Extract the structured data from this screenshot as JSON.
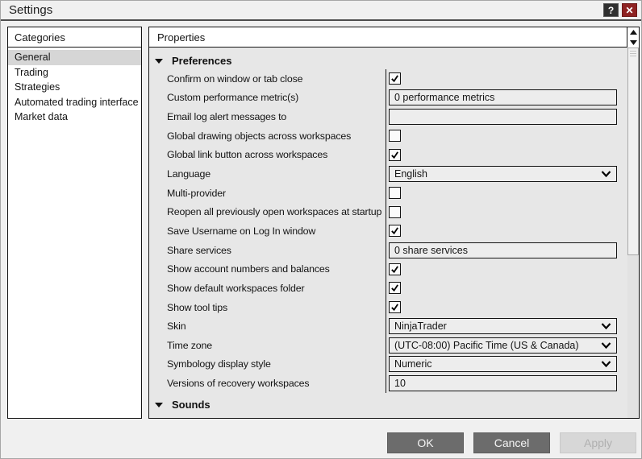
{
  "window": {
    "title": "Settings",
    "help_label": "?",
    "close_label": "✕"
  },
  "categories": {
    "header": "Categories",
    "items": [
      {
        "label": "General",
        "selected": true
      },
      {
        "label": "Trading",
        "selected": false
      },
      {
        "label": "Strategies",
        "selected": false
      },
      {
        "label": "Automated trading interface",
        "selected": false
      },
      {
        "label": "Market data",
        "selected": false
      }
    ]
  },
  "properties": {
    "header": "Properties",
    "sections": [
      {
        "title": "Preferences",
        "expanded": true,
        "rows": [
          {
            "label": "Confirm on window or tab close",
            "type": "checkbox",
            "checked": true
          },
          {
            "label": "Custom performance metric(s)",
            "type": "text",
            "value": "0 performance metrics"
          },
          {
            "label": "Email log alert messages to",
            "type": "text",
            "value": ""
          },
          {
            "label": "Global drawing objects across workspaces",
            "type": "checkbox",
            "checked": false
          },
          {
            "label": "Global link button across workspaces",
            "type": "checkbox",
            "checked": true
          },
          {
            "label": "Language",
            "type": "dropdown",
            "value": "English"
          },
          {
            "label": "Multi-provider",
            "type": "checkbox",
            "checked": false
          },
          {
            "label": "Reopen all previously open workspaces at startup",
            "type": "checkbox",
            "checked": false
          },
          {
            "label": "Save Username on Log In window",
            "type": "checkbox",
            "checked": true
          },
          {
            "label": "Share services",
            "type": "text",
            "value": "0 share services"
          },
          {
            "label": "Show account numbers and balances",
            "type": "checkbox",
            "checked": true
          },
          {
            "label": "Show default workspaces folder",
            "type": "checkbox",
            "checked": true
          },
          {
            "label": "Show tool tips",
            "type": "checkbox",
            "checked": true
          },
          {
            "label": "Skin",
            "type": "dropdown",
            "value": "NinjaTrader"
          },
          {
            "label": "Time zone",
            "type": "dropdown",
            "value": "(UTC-08:00) Pacific Time (US & Canada)"
          },
          {
            "label": "Symbology display style",
            "type": "dropdown",
            "value": "Numeric"
          },
          {
            "label": "Versions of recovery workspaces",
            "type": "text",
            "value": "10"
          }
        ]
      },
      {
        "title": "Sounds",
        "expanded": true,
        "rows": []
      }
    ]
  },
  "footer": {
    "ok_label": "OK",
    "cancel_label": "Cancel",
    "apply_label": "Apply",
    "apply_enabled": false
  },
  "colors": {
    "window_bg": "#f0f0f0",
    "panel_border": "#141414",
    "content_bg": "#e7e7e7",
    "field_bg": "#ededed",
    "selected_item_bg": "#d6d6d6",
    "button_bg": "#6c6c6c",
    "disabled_button_bg": "#d7d7d7",
    "close_button_bg": "#8e2222",
    "help_button_bg": "#303030"
  }
}
